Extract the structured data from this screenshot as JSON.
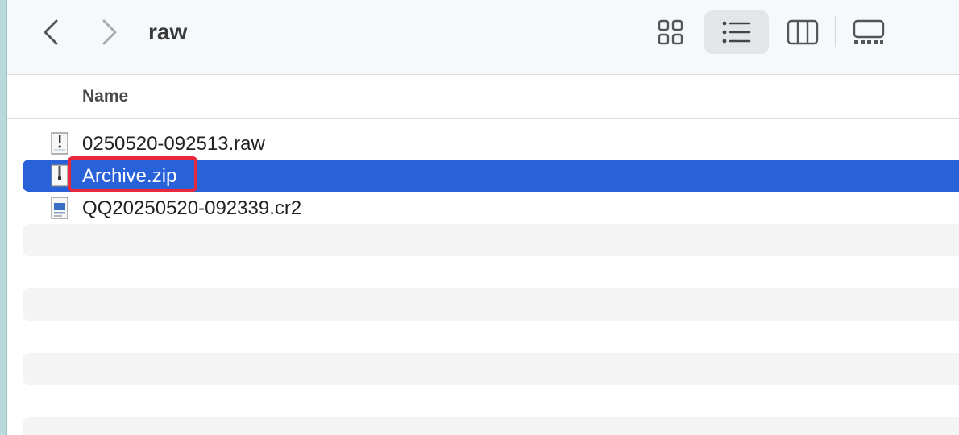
{
  "toolbar": {
    "title": "raw",
    "back_icon": "chevron-left-icon",
    "forward_icon": "chevron-right-icon",
    "views": [
      "icon-view",
      "list-view",
      "column-view",
      "gallery-view"
    ],
    "active_view": "list-view"
  },
  "header": {
    "name_column": "Name"
  },
  "files": [
    {
      "name": "0250520-092513.raw",
      "icon": "raw-file-icon",
      "selected": false
    },
    {
      "name": "Archive.zip",
      "icon": "zip-file-icon",
      "selected": true
    },
    {
      "name": "QQ20250520-092339.cr2",
      "icon": "image-file-icon",
      "selected": false
    }
  ],
  "colors": {
    "selection": "#2962d8",
    "highlight_box": "#e8283a",
    "toolbar_bg": "#f5f9fc",
    "stripe": "#f4f4f4"
  }
}
